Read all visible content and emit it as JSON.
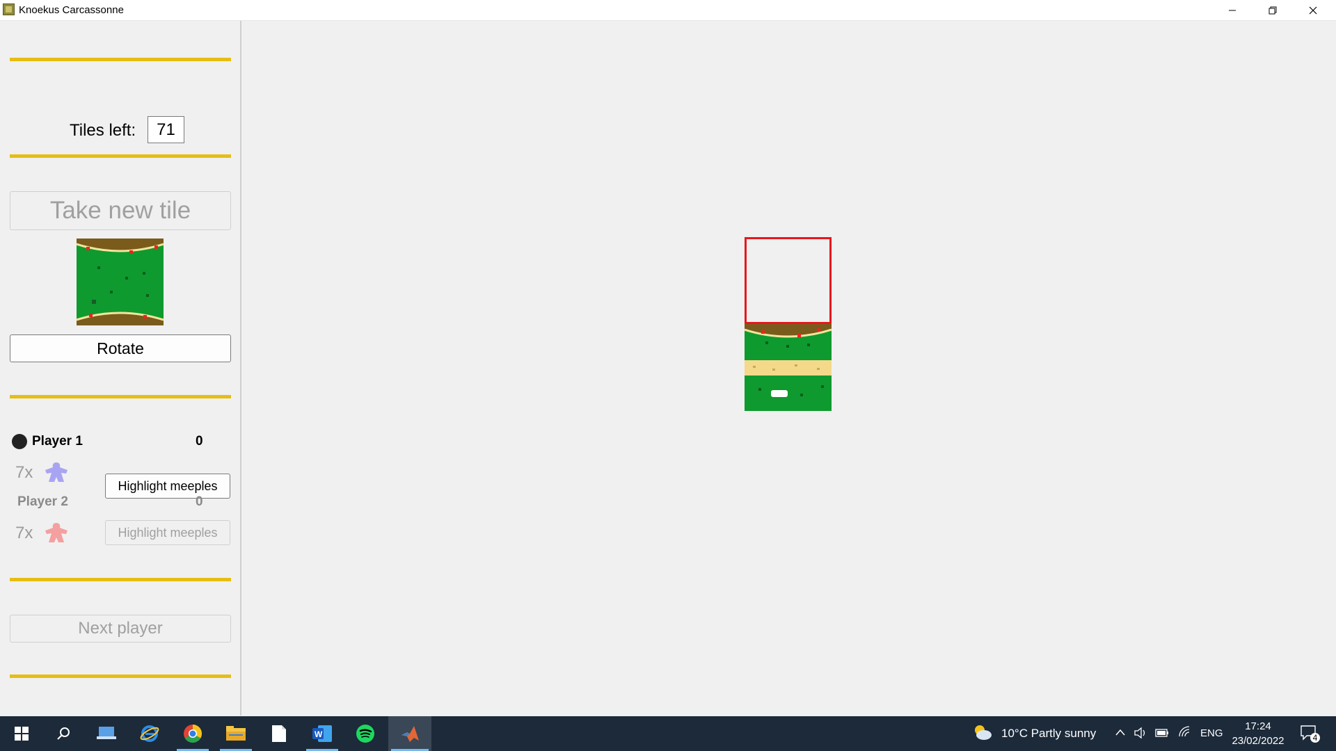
{
  "window": {
    "title": "Knoekus Carcassonne",
    "controls": [
      "minimize-icon",
      "restore-icon",
      "close-icon"
    ]
  },
  "sidebar": {
    "tiles_left_label": "Tiles left:",
    "tiles_left_value": "71",
    "take_new_tile_label": "Take new tile",
    "rotate_label": "Rotate",
    "players": [
      {
        "name": "Player 1",
        "score": "0",
        "meeples": "7x",
        "meeple_color": "#a9a4f2",
        "highlight_label": "Highlight meeples",
        "active": true
      },
      {
        "name": "Player 2",
        "score": "0",
        "meeples": "7x",
        "meeple_color": "#f4a0a0",
        "highlight_label": "Highlight meeples",
        "active": false
      }
    ],
    "next_player_label": "Next player",
    "accent_color": "#e6be13"
  },
  "board": {
    "highlight_color": "#e8161b",
    "tiles": [
      "city-caps-tile",
      "road-tile"
    ]
  },
  "taskbar": {
    "apps": [
      "start-icon",
      "search-icon",
      "remote-desktop-icon",
      "internet-explorer-icon",
      "chrome-icon",
      "file-explorer-icon",
      "document-icon",
      "word-icon",
      "spotify-icon",
      "matlab-icon"
    ],
    "weather": "10°C  Partly sunny",
    "language": "ENG",
    "time": "17:24",
    "date": "23/02/2022",
    "notifications": "4"
  }
}
